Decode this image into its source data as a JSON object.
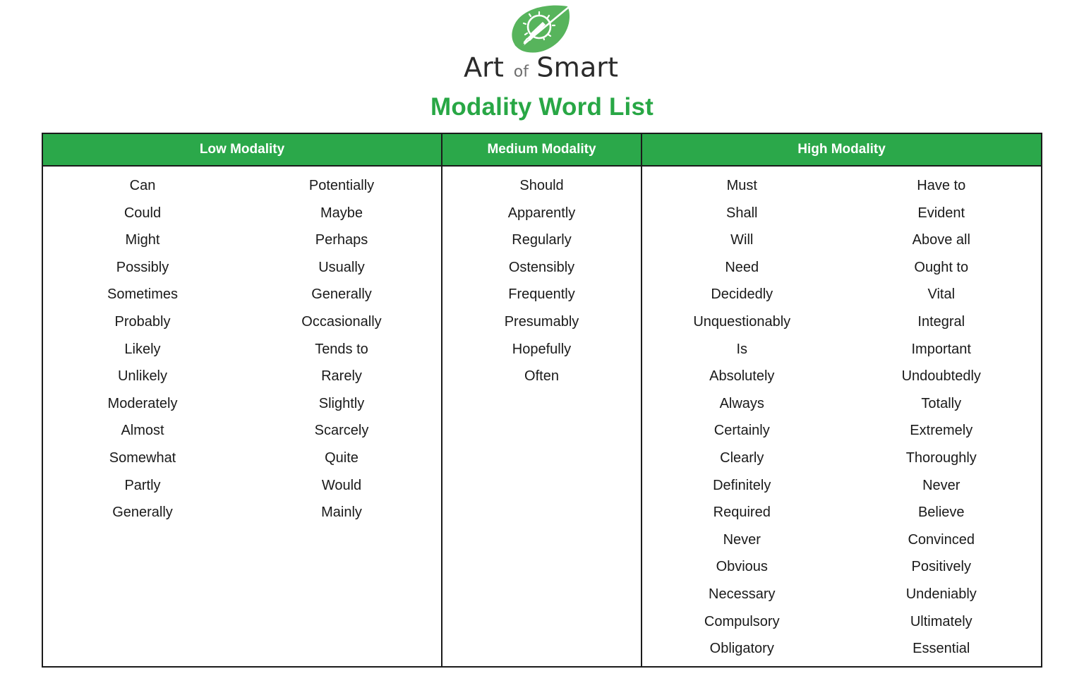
{
  "brand": {
    "name": "Art of Smart",
    "name_part_1": "Art",
    "name_part_2": "of",
    "name_part_3": "Smart",
    "logo_icon": "leaf-lightbulb-icon",
    "leaf_color": "#57b45c",
    "wordmark_color": "#2b2b2b"
  },
  "page": {
    "title": "Modality Word List",
    "title_color": "#28a745"
  },
  "table": {
    "header_bg": "#2ba84a",
    "header_text_color": "#ffffff",
    "border_color": "#1b1b1b",
    "columns": [
      {
        "header": "Low Modality",
        "subcolumns": [
          [
            "Can",
            "Could",
            "Might",
            "Possibly",
            "Sometimes",
            "Probably",
            "Likely",
            "Unlikely",
            "Moderately",
            "Almost",
            "Somewhat",
            "Partly",
            "Generally"
          ],
          [
            "Potentially",
            "Maybe",
            "Perhaps",
            "Usually",
            "Generally",
            "Occasionally",
            "Tends to",
            "Rarely",
            "Slightly",
            "Scarcely",
            "Quite",
            "Would",
            "Mainly"
          ]
        ]
      },
      {
        "header": "Medium Modality",
        "subcolumns": [
          [
            "Should",
            "Apparently",
            "Regularly",
            "Ostensibly",
            "Frequently",
            "Presumably",
            "Hopefully",
            "Often"
          ]
        ]
      },
      {
        "header": "High Modality",
        "subcolumns": [
          [
            "Must",
            "Shall",
            "Will",
            "Need",
            "Decidedly",
            "Unquestionably",
            "Is",
            "Absolutely",
            "Always",
            "Certainly",
            "Clearly",
            "Definitely",
            "Required",
            "Never",
            "Obvious",
            "Necessary",
            "Compulsory",
            "Obligatory"
          ],
          [
            "Have to",
            "Evident",
            "Above all",
            "Ought to",
            "Vital",
            "Integral",
            "Important",
            "Undoubtedly",
            "Totally",
            "Extremely",
            "Thoroughly",
            "Never",
            "Believe",
            "Convinced",
            "Positively",
            "Undeniably",
            "Ultimately",
            "Essential"
          ]
        ]
      }
    ]
  }
}
